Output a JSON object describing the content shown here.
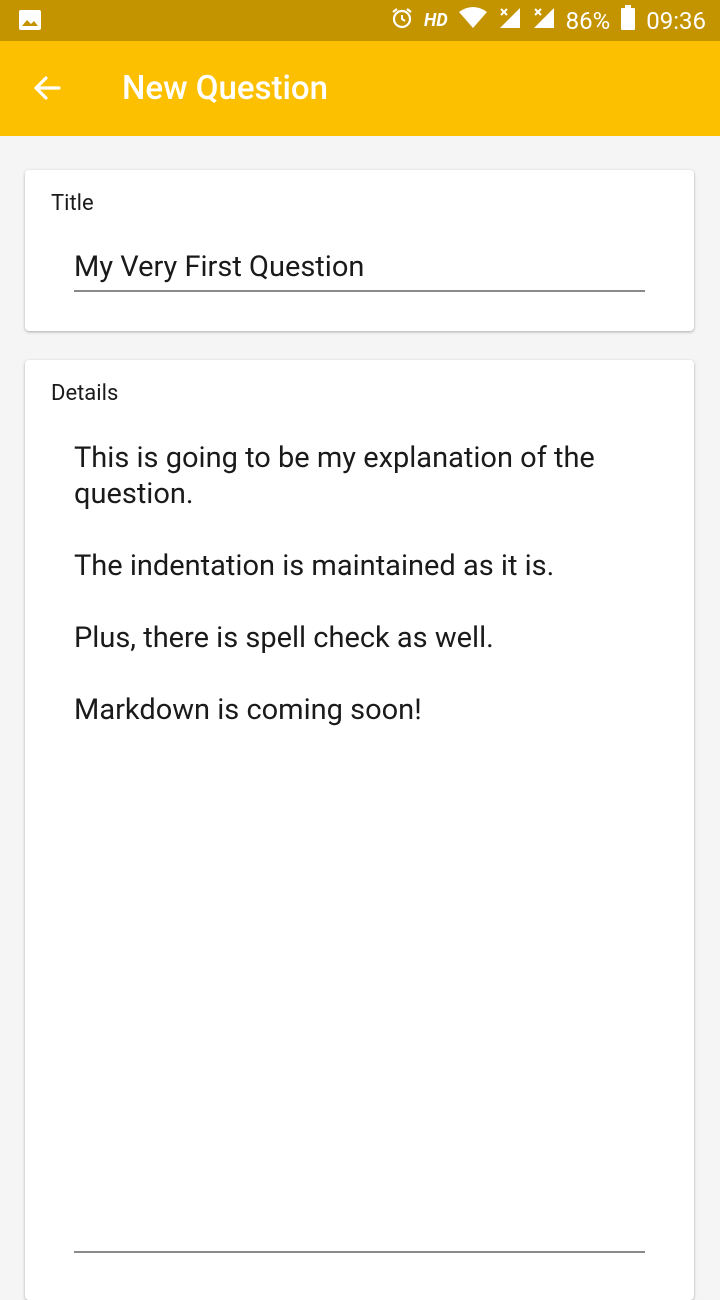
{
  "status_bar": {
    "icons_left": [
      "image-icon"
    ],
    "icons_right": [
      "alarm-icon",
      "wifi-icon",
      "signal-icon",
      "signal-icon",
      "battery-icon"
    ],
    "hd_label": "HD",
    "battery_text": "86%",
    "time": "09:36"
  },
  "app_bar": {
    "title": "New Question",
    "back_icon": "arrow-back-icon",
    "colors": {
      "app_bar": "#fcc000",
      "status_bar": "#c49400"
    }
  },
  "title_card": {
    "label": "Title",
    "value": "My Very First Question"
  },
  "details_card": {
    "label": "Details",
    "paragraphs": [
      "This is going to be my explanation of the question.",
      "The indentation is maintained as it is.",
      "Plus, there is spell check as well.",
      "Markdown is coming soon!"
    ]
  }
}
